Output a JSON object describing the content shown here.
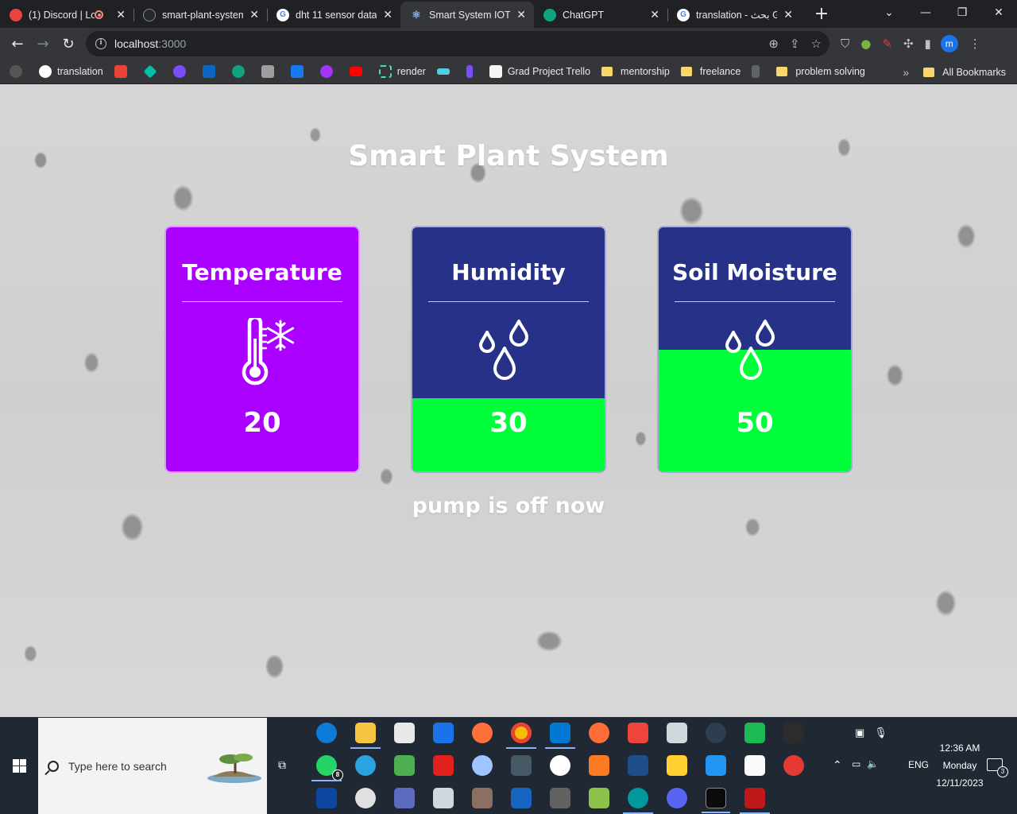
{
  "browser": {
    "tabs": [
      {
        "title": "(1) Discord | Lo",
        "favicon_color": "#e8453c",
        "recording": true
      },
      {
        "title": "smart-plant-system",
        "favicon_color": "#24292f"
      },
      {
        "title": "dht 11 sensor data",
        "favicon_color": "#4285f4"
      },
      {
        "title": "Smart System IOT",
        "favicon_color": "#8ab4f8",
        "active": true
      },
      {
        "title": "ChatGPT",
        "favicon_color": "#10a37f"
      },
      {
        "title": "translation - بحث G",
        "favicon_color": "#4285f4"
      }
    ],
    "new_tab": "+",
    "window_controls": {
      "minimize": "—",
      "restore": "❐",
      "close": "✕"
    },
    "url": {
      "host": "localhost",
      "port": ":3000"
    },
    "profile_initial": "m",
    "bookmarks": [
      {
        "label": "translation",
        "color": "#4285f4"
      },
      {
        "label": "render",
        "color": "#46e3b7"
      },
      {
        "label": "Grad Project Trello",
        "color": "#0079bf"
      },
      {
        "label": "mentorship",
        "folder": true
      },
      {
        "label": "freelance",
        "folder": true
      },
      {
        "label": "problem solving",
        "folder": true
      }
    ],
    "bookmark_icons": [
      "#e8e8e8",
      "#ea4335",
      "#00bfa5",
      "#7c4dff",
      "#0a66c2",
      "#10a37f",
      "#9e9e9e",
      "#1877f2",
      "#a334fa",
      "#ff0000",
      "#00bcd4",
      "#4dd0e1",
      "#7c4dff"
    ],
    "all_bookmarks": "All Bookmarks",
    "overflow": "»"
  },
  "page": {
    "title": "Smart Plant System",
    "cards": [
      {
        "label": "Temperature",
        "value": "20",
        "fill_fraction": 0,
        "color": "#aa00ff"
      },
      {
        "label": "Humidity",
        "value": "30",
        "fill_fraction": 0.3,
        "color": "#263187"
      },
      {
        "label": "Soil Moisture",
        "value": "50",
        "fill_fraction": 0.5,
        "color": "#263187"
      }
    ],
    "fill_color": "#00ff3b",
    "pump_status": "pump is off now"
  },
  "taskbar": {
    "search_placeholder": "Type here to search",
    "whatsapp_badge": "8",
    "language": "ENG",
    "time": "12:36 AM",
    "day": "Monday",
    "date": "12/11/2023",
    "notification_count": "3"
  }
}
